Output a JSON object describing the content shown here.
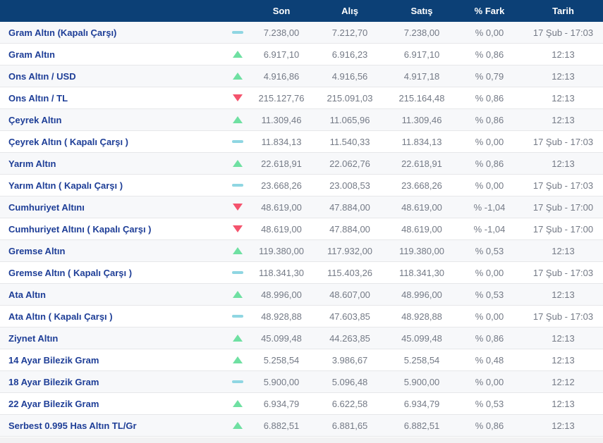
{
  "table": {
    "columns": [
      "Son",
      "Alış",
      "Satış",
      "% Fark",
      "Tarih"
    ],
    "rows": [
      {
        "name": "Gram Altın (Kapalı Çarşı)",
        "trend": "flat",
        "son": "7.238,00",
        "alis": "7.212,70",
        "satis": "7.238,00",
        "fark": "% 0,00",
        "tarih": "17 Şub - 17:03"
      },
      {
        "name": "Gram Altın",
        "trend": "up",
        "son": "6.917,10",
        "alis": "6.916,23",
        "satis": "6.917,10",
        "fark": "% 0,86",
        "tarih": "12:13"
      },
      {
        "name": "Ons Altın / USD",
        "trend": "up",
        "son": "4.916,86",
        "alis": "4.916,56",
        "satis": "4.917,18",
        "fark": "% 0,79",
        "tarih": "12:13"
      },
      {
        "name": "Ons Altın / TL",
        "trend": "down",
        "son": "215.127,76",
        "alis": "215.091,03",
        "satis": "215.164,48",
        "fark": "% 0,86",
        "tarih": "12:13"
      },
      {
        "name": "Çeyrek Altın",
        "trend": "up",
        "son": "11.309,46",
        "alis": "11.065,96",
        "satis": "11.309,46",
        "fark": "% 0,86",
        "tarih": "12:13"
      },
      {
        "name": "Çeyrek Altın ( Kapalı Çarşı )",
        "trend": "flat",
        "son": "11.834,13",
        "alis": "11.540,33",
        "satis": "11.834,13",
        "fark": "% 0,00",
        "tarih": "17 Şub - 17:03"
      },
      {
        "name": "Yarım Altın",
        "trend": "up",
        "son": "22.618,91",
        "alis": "22.062,76",
        "satis": "22.618,91",
        "fark": "% 0,86",
        "tarih": "12:13"
      },
      {
        "name": "Yarım Altın ( Kapalı Çarşı )",
        "trend": "flat",
        "son": "23.668,26",
        "alis": "23.008,53",
        "satis": "23.668,26",
        "fark": "% 0,00",
        "tarih": "17 Şub - 17:03"
      },
      {
        "name": "Cumhuriyet Altını",
        "trend": "down",
        "son": "48.619,00",
        "alis": "47.884,00",
        "satis": "48.619,00",
        "fark": "% -1,04",
        "tarih": "17 Şub - 17:00"
      },
      {
        "name": "Cumhuriyet Altını ( Kapalı Çarşı )",
        "trend": "down",
        "son": "48.619,00",
        "alis": "47.884,00",
        "satis": "48.619,00",
        "fark": "% -1,04",
        "tarih": "17 Şub - 17:00"
      },
      {
        "name": "Gremse Altın",
        "trend": "up",
        "son": "119.380,00",
        "alis": "117.932,00",
        "satis": "119.380,00",
        "fark": "% 0,53",
        "tarih": "12:13"
      },
      {
        "name": "Gremse Altın ( Kapalı Çarşı )",
        "trend": "flat",
        "son": "118.341,30",
        "alis": "115.403,26",
        "satis": "118.341,30",
        "fark": "% 0,00",
        "tarih": "17 Şub - 17:03"
      },
      {
        "name": "Ata Altın",
        "trend": "up",
        "son": "48.996,00",
        "alis": "48.607,00",
        "satis": "48.996,00",
        "fark": "% 0,53",
        "tarih": "12:13"
      },
      {
        "name": "Ata Altın ( Kapalı Çarşı )",
        "trend": "flat",
        "son": "48.928,88",
        "alis": "47.603,85",
        "satis": "48.928,88",
        "fark": "% 0,00",
        "tarih": "17 Şub - 17:03"
      },
      {
        "name": "Ziynet Altın",
        "trend": "up",
        "son": "45.099,48",
        "alis": "44.263,85",
        "satis": "45.099,48",
        "fark": "% 0,86",
        "tarih": "12:13"
      },
      {
        "name": "14 Ayar Bilezik Gram",
        "trend": "up",
        "son": "5.258,54",
        "alis": "3.986,67",
        "satis": "5.258,54",
        "fark": "% 0,48",
        "tarih": "12:13"
      },
      {
        "name": "18 Ayar Bilezik Gram",
        "trend": "flat",
        "son": "5.900,00",
        "alis": "5.096,48",
        "satis": "5.900,00",
        "fark": "% 0,00",
        "tarih": "12:12"
      },
      {
        "name": "22 Ayar Bilezik Gram",
        "trend": "up",
        "son": "6.934,79",
        "alis": "6.622,58",
        "satis": "6.934,79",
        "fark": "% 0,53",
        "tarih": "12:13"
      },
      {
        "name": "Serbest 0.995 Has Altın TL/Gr",
        "trend": "up",
        "son": "6.882,51",
        "alis": "6.881,65",
        "satis": "6.882,51",
        "fark": "% 0,86",
        "tarih": "12:13"
      }
    ]
  },
  "colors": {
    "header_bg": "#0c4076",
    "header_text": "#ffffff",
    "name_text": "#1e3e97",
    "value_text": "#747a86",
    "up": "#6fe0a2",
    "down": "#f4536d",
    "flat": "#8fd6e2",
    "row_alt_bg": "#f7f8fa",
    "separator": "#e6e7e9",
    "footer_bg": "#f2f2f3"
  }
}
